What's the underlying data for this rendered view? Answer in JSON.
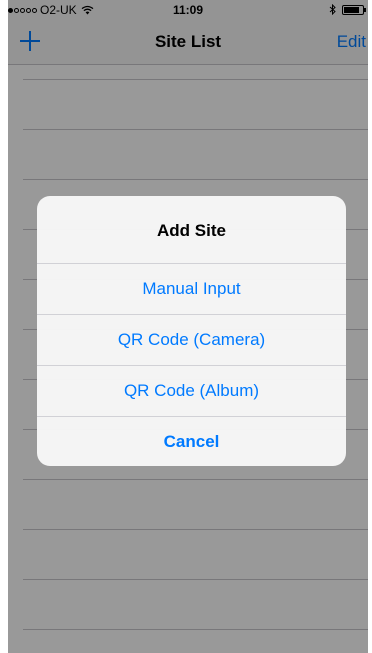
{
  "status_bar": {
    "signal_dots_filled": 1,
    "signal_dots_total": 5,
    "carrier": "O2-UK",
    "wifi_icon": "wifi-icon",
    "time": "11:09",
    "bluetooth_icon": "bluetooth-icon",
    "battery_icon": "battery-icon",
    "battery_level": 0.85
  },
  "nav": {
    "add_icon": "plus-icon",
    "title": "Site List",
    "edit_label": "Edit"
  },
  "alert": {
    "title": "Add Site",
    "actions": [
      {
        "label": "Manual Input"
      },
      {
        "label": "QR Code (Camera)"
      },
      {
        "label": "QR Code (Album)"
      },
      {
        "label": "Cancel"
      }
    ]
  },
  "colors": {
    "accent": "#007aff",
    "overlay": "rgba(0,0,0,0.40)",
    "separator": "#c8c7cc"
  }
}
